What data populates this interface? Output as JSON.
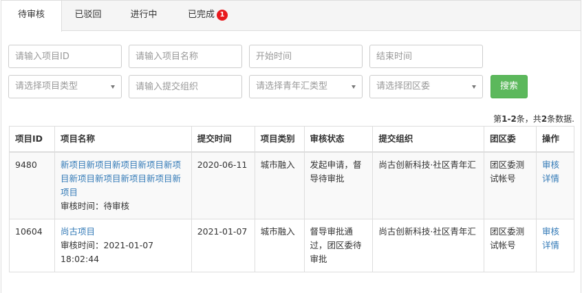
{
  "tabs": [
    {
      "label": "待审核",
      "active": true
    },
    {
      "label": "已驳回",
      "active": false
    },
    {
      "label": "进行中",
      "active": false
    },
    {
      "label": "已完成",
      "active": false,
      "badge": "1"
    }
  ],
  "filters": {
    "project_id_placeholder": "请输入项目ID",
    "project_name_placeholder": "请输入项目名称",
    "start_time_placeholder": "开始时间",
    "end_time_placeholder": "结束时间",
    "project_type_select": "请选择项目类型",
    "org_placeholder": "请输入提交组织",
    "youth_type_select": "请选择青年汇类型",
    "district_select": "请选择团区委",
    "search_label": "搜索"
  },
  "summary": {
    "prefix": "第",
    "range": "1-2",
    "middle": "条，共",
    "total": "2",
    "suffix": "条数据."
  },
  "table": {
    "headers": [
      "项目ID",
      "项目名称",
      "提交时间",
      "项目类别",
      "审核状态",
      "提交组织",
      "团区委",
      "操作"
    ],
    "rows": [
      {
        "id": "9480",
        "name": "新项目新项目新项目新项目新项目新项目新项目新项目新项目新项目",
        "review_time": "审核时间：待审核",
        "submit_time": "2020-06-11",
        "category": "城市融入",
        "status": "发起申请，督导待审批",
        "org": "尚古创新科技·社区青年汇",
        "committee": "团区委测试帐号",
        "action_review": "审核",
        "action_detail": "详情"
      },
      {
        "id": "10604",
        "name": "尚古项目",
        "review_time": "审核时间：2021-01-07 18:02:44",
        "submit_time": "2021-01-07",
        "category": "城市融入",
        "status": "督导审批通过，团区委待审批",
        "org": "尚古创新科技·社区青年汇",
        "committee": "团区委测试帐号",
        "action_review": "审核",
        "action_detail": "详情"
      }
    ]
  },
  "colors": {
    "link": "#337ab7",
    "search_button": "#5cb85c",
    "badge": "#e8191d"
  }
}
